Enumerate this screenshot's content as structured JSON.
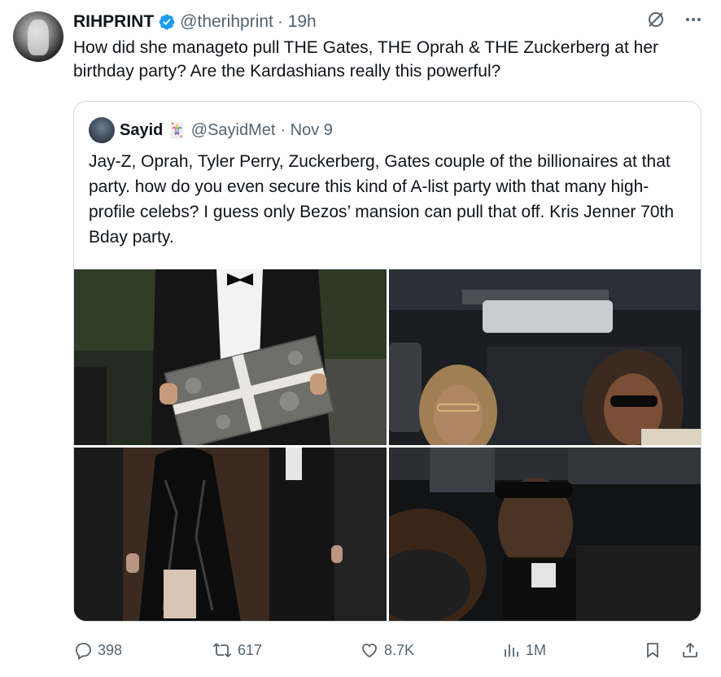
{
  "author": {
    "name": "RIHPRINT",
    "handle": "@therihprint",
    "time": "· 19h"
  },
  "tweet": {
    "text": "How did she manageto pull THE Gates, THE Oprah & THE Zuckerberg at her birthday party? Are the Kardashians really this powerful?"
  },
  "quoted": {
    "name": "Sayid",
    "badge_emoji": "🃏",
    "handle": "@SayidMet",
    "time": "· Nov 9",
    "text": "Jay-Z, Oprah, Tyler Perry, Zuckerberg, Gates couple of the billionaires at that party. how do you even secure this kind of A-list party with that many high-profile celebs? I guess only Bezos’ mansion can pull that off. Kris Jenner 70th Bday party."
  },
  "actions": {
    "replies": "398",
    "reposts": "617",
    "likes": "8.7K",
    "views": "1M"
  },
  "icons": {
    "verified": "verified-badge-icon",
    "grok": "grok-icon",
    "more": "more-icon",
    "reply": "reply-icon",
    "repost": "repost-icon",
    "like": "like-icon",
    "views": "views-icon",
    "bookmark": "bookmark-icon",
    "share": "share-icon"
  },
  "colors": {
    "verified": "#1d9bf0",
    "muted": "#536471",
    "border": "#cfd9de"
  }
}
